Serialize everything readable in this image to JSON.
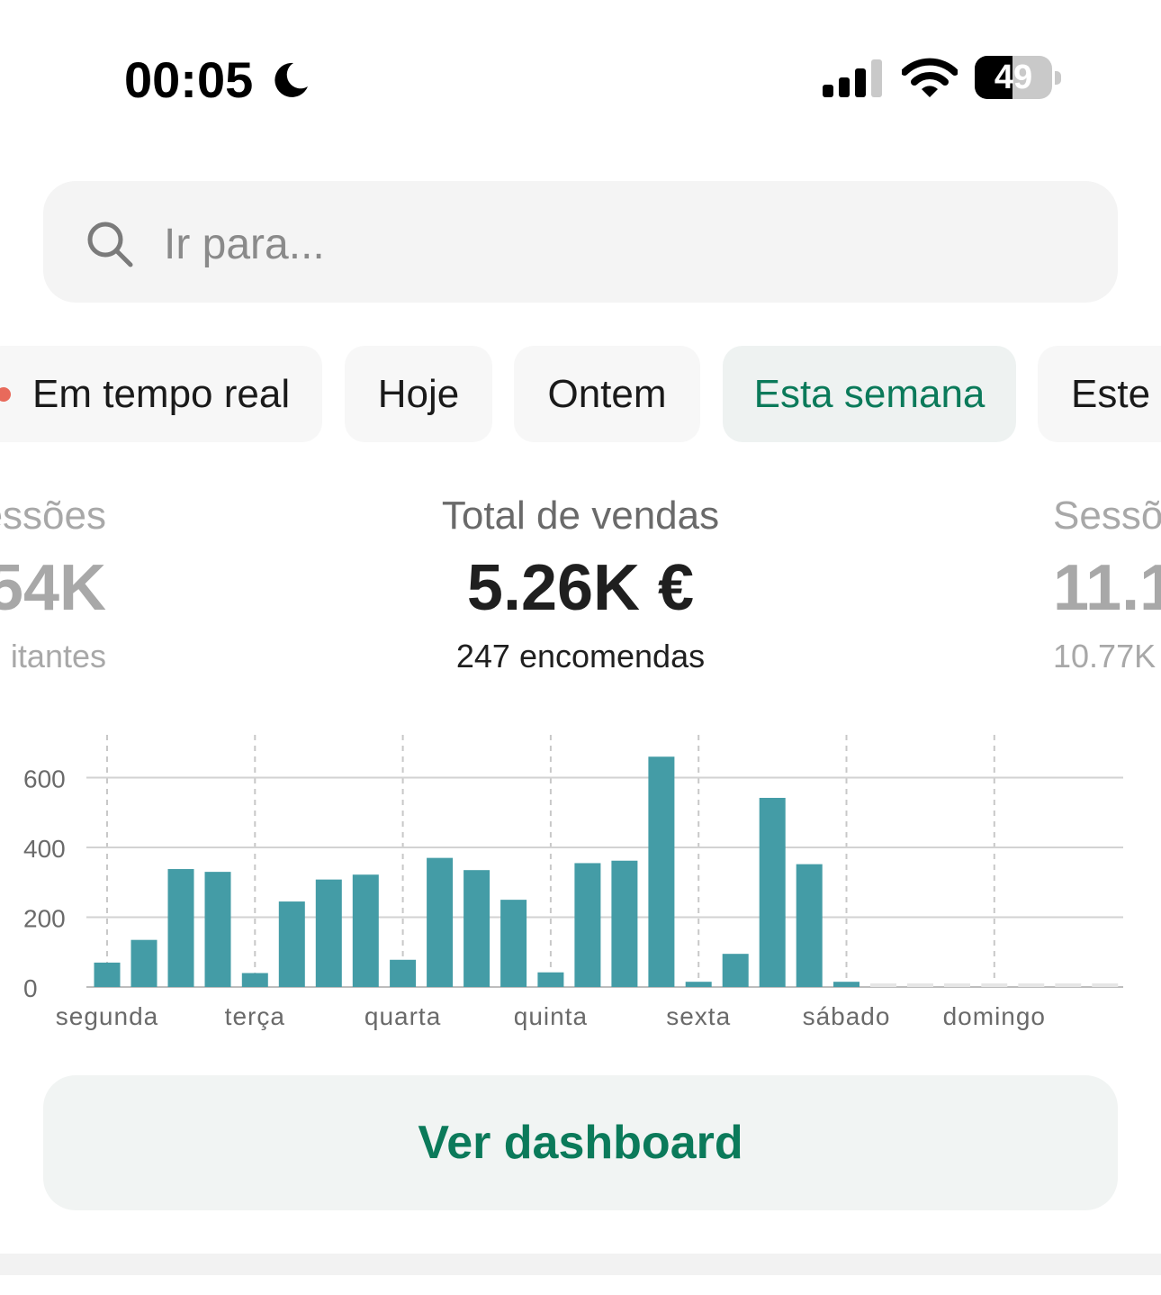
{
  "status_bar": {
    "time": "00:05",
    "battery": "49",
    "battery_level": 0.49
  },
  "search": {
    "placeholder": "Ir para..."
  },
  "periods": [
    {
      "label": "Em tempo real",
      "live": true
    },
    {
      "label": "Hoje"
    },
    {
      "label": "Ontem"
    },
    {
      "label": "Esta semana",
      "active": true
    },
    {
      "label": "Este"
    }
  ],
  "metrics": {
    "left": {
      "label": "essões",
      "value": "54K",
      "sub": "itantes"
    },
    "center": {
      "label": "Total de vendas",
      "value": "5.26K €",
      "sub": "247 encomendas"
    },
    "right": {
      "label": "Sessõ",
      "value": "11.1",
      "sub": "10.77K"
    }
  },
  "colors": {
    "accent": "#0b7a5a",
    "bar": "#449ca6",
    "live_dot": "#e86a5b"
  },
  "chart_data": {
    "type": "bar",
    "categories": [
      "segunda",
      "terça",
      "quarta",
      "quinta",
      "sexta",
      "sábado",
      "domingo"
    ],
    "bars_per_category": 4,
    "values": [
      70,
      135,
      338,
      330,
      40,
      245,
      308,
      322,
      78,
      370,
      335,
      250,
      42,
      355,
      362,
      660,
      15,
      95,
      542,
      352,
      15,
      null,
      null,
      null,
      null,
      null,
      null,
      null
    ],
    "yticks": [
      0,
      200,
      400,
      600
    ],
    "ylim": [
      0,
      700
    ],
    "grid": true
  },
  "button": {
    "label": "Ver dashboard"
  }
}
